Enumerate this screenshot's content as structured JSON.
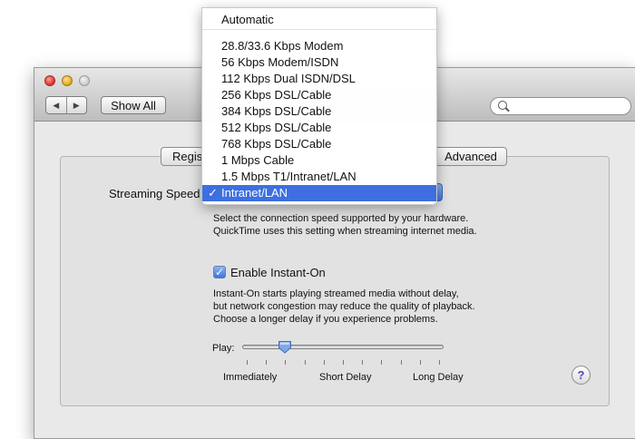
{
  "toolbar": {
    "nav_back": "◀",
    "nav_forward": "▶",
    "show_all_label": "Show All",
    "search_placeholder": ""
  },
  "tabs": {
    "registration_partial": "Regis",
    "advanced": "Advanced"
  },
  "streaming": {
    "label": "Streaming Speed",
    "desc_line1": "Select the connection speed supported by your hardware.",
    "desc_line2": "QuickTime uses this setting when streaming internet media."
  },
  "speed_menu": {
    "options": [
      "Automatic",
      "28.8/33.6 Kbps Modem",
      "56 Kbps Modem/ISDN",
      "112 Kbps Dual ISDN/DSL",
      "256 Kbps DSL/Cable",
      "384 Kbps DSL/Cable",
      "512 Kbps DSL/Cable",
      "768 Kbps DSL/Cable",
      "1 Mbps Cable",
      "1.5 Mbps T1/Intranet/LAN",
      "Intranet/LAN"
    ],
    "selected": "Intranet/LAN",
    "check_mark": "✓"
  },
  "instant_on": {
    "checkbox_label": "Enable Instant-On",
    "checked": true,
    "desc_line1": "Instant-On starts playing streamed media without delay,",
    "desc_line2": "but network congestion may reduce the quality of playback.",
    "desc_line3": "Choose a longer delay if you experience problems."
  },
  "play_slider": {
    "label": "Play:",
    "min_label": "Immediately",
    "mid_label": "Short Delay",
    "max_label": "Long Delay",
    "position_fraction": 0.2
  },
  "help": {
    "label": "?"
  },
  "colors": {
    "selection": "#3d6fe0",
    "help_glyph": "#5a3fc0"
  }
}
